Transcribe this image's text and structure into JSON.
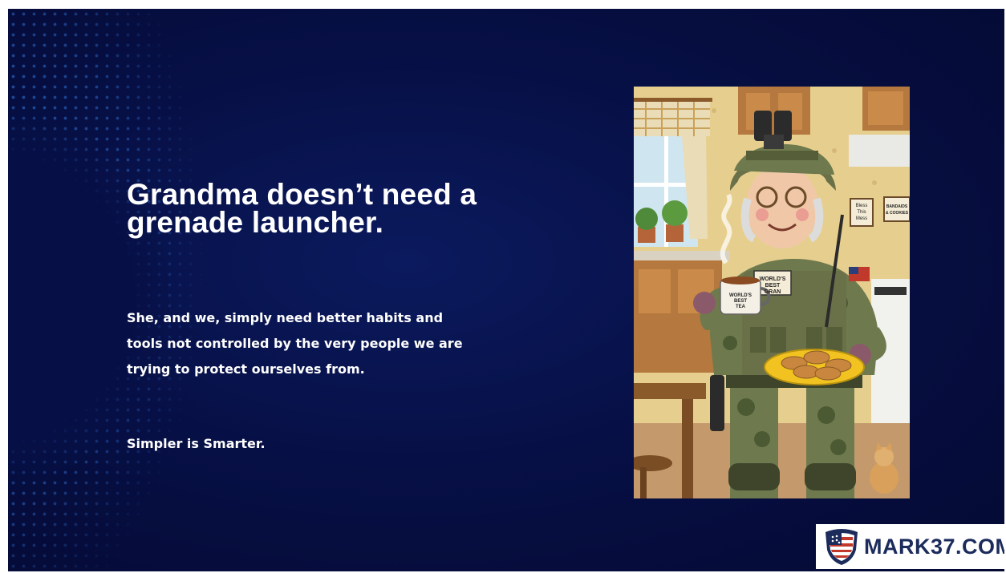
{
  "slide": {
    "headline": "Grandma doesn’t need a grenade launcher.",
    "body": "She, and we, simply need better habits and tools not controlled by the very people we are trying to protect ourselves from.",
    "tagline": "Simpler is Smarter."
  },
  "illustration": {
    "icon": "grandma-soldier-illustration",
    "patch_text": "WORLD'S BEST GRAN",
    "mug_text": "WORLD'S BEST TEA",
    "sign_left": "Bless This Mess",
    "sign_right": "BANDAIDS & COOKIES"
  },
  "logo": {
    "icon": "flag-shield-icon",
    "text": "MARK37.COM"
  },
  "colors": {
    "background": "#071046",
    "dots": "#3478dc",
    "text": "#ffffff",
    "logo_text": "#1b2b5c"
  }
}
